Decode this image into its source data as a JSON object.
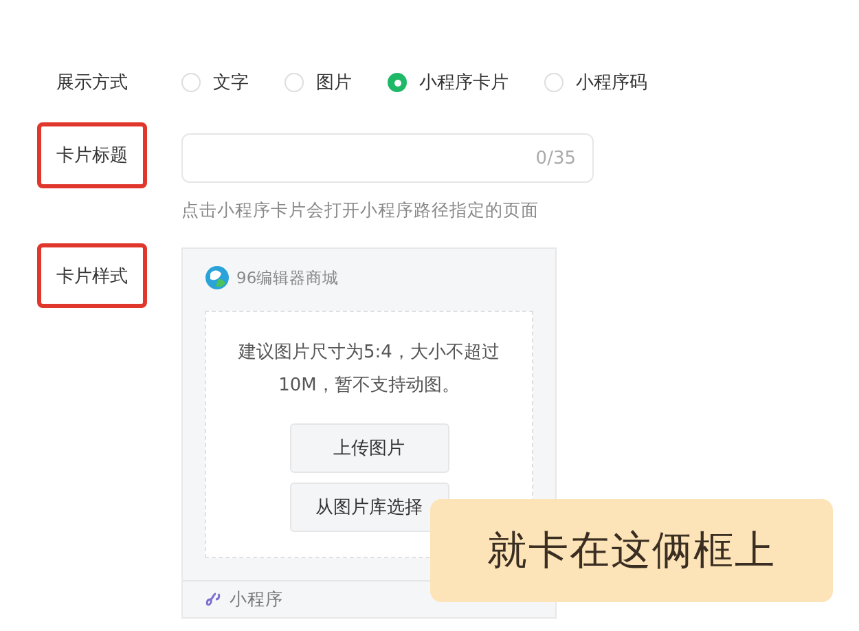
{
  "display_mode": {
    "label": "展示方式",
    "options": [
      {
        "label": "文字",
        "selected": false
      },
      {
        "label": "图片",
        "selected": false
      },
      {
        "label": "小程序卡片",
        "selected": true
      },
      {
        "label": "小程序码",
        "selected": false
      }
    ]
  },
  "card_title": {
    "label": "卡片标题",
    "highlighted": true,
    "counter": "0/35",
    "hint": "点击小程序卡片会打开小程序路径指定的页面"
  },
  "card_style": {
    "label": "卡片样式",
    "highlighted": true,
    "app_name": "96编辑器商城",
    "upload_hint": "建议图片尺寸为5:4，大小不超过10M，暂不支持动图。",
    "buttons": [
      "上传图片",
      "从图片库选择"
    ],
    "footer": "小程序"
  },
  "annotation": "就卡在这俩框上"
}
